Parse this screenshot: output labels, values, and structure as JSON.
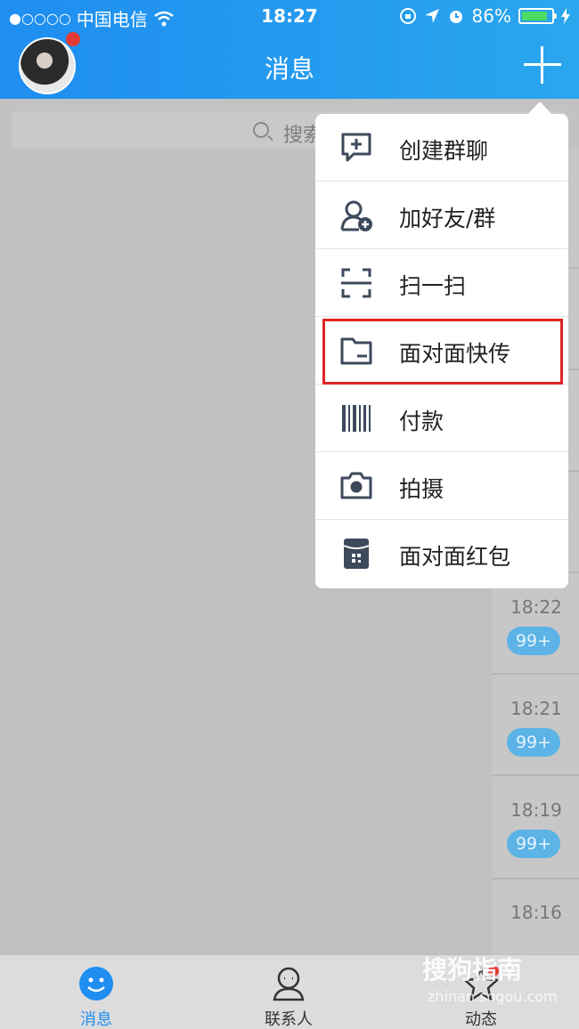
{
  "status_bar": {
    "signal": "●○○○○",
    "carrier": "中国电信",
    "time": "18:27",
    "battery": "86%",
    "battery_level": 0.86
  },
  "header": {
    "title": "消息"
  },
  "search": {
    "placeholder": "搜索"
  },
  "menu": {
    "items": [
      {
        "label": "创建群聊",
        "icon": "create-group-chat-icon"
      },
      {
        "label": "加好友/群",
        "icon": "add-friend-icon"
      },
      {
        "label": "扫一扫",
        "icon": "scan-icon"
      },
      {
        "label": "面对面快传",
        "icon": "folder-transfer-icon"
      },
      {
        "label": "付款",
        "icon": "barcode-icon"
      },
      {
        "label": "拍摄",
        "icon": "camera-icon"
      },
      {
        "label": "面对面红包",
        "icon": "red-packet-icon"
      }
    ]
  },
  "conversations": [
    {
      "time": "18:22",
      "badge": "99+"
    },
    {
      "time": "18:21",
      "badge": "99+"
    },
    {
      "time": "18:19",
      "badge": "99+"
    },
    {
      "time": "18:16",
      "badge": ""
    }
  ],
  "tabs": [
    {
      "label": "消息",
      "active": true
    },
    {
      "label": "联系人",
      "active": false
    },
    {
      "label": "动态",
      "active": false
    }
  ],
  "watermark": {
    "text": "搜狗指南",
    "url": "zhinan.sogou.com"
  },
  "colors": {
    "header_accent": "#1f8ef0",
    "highlight": "#e02424",
    "badge": "#5cb3e6"
  }
}
